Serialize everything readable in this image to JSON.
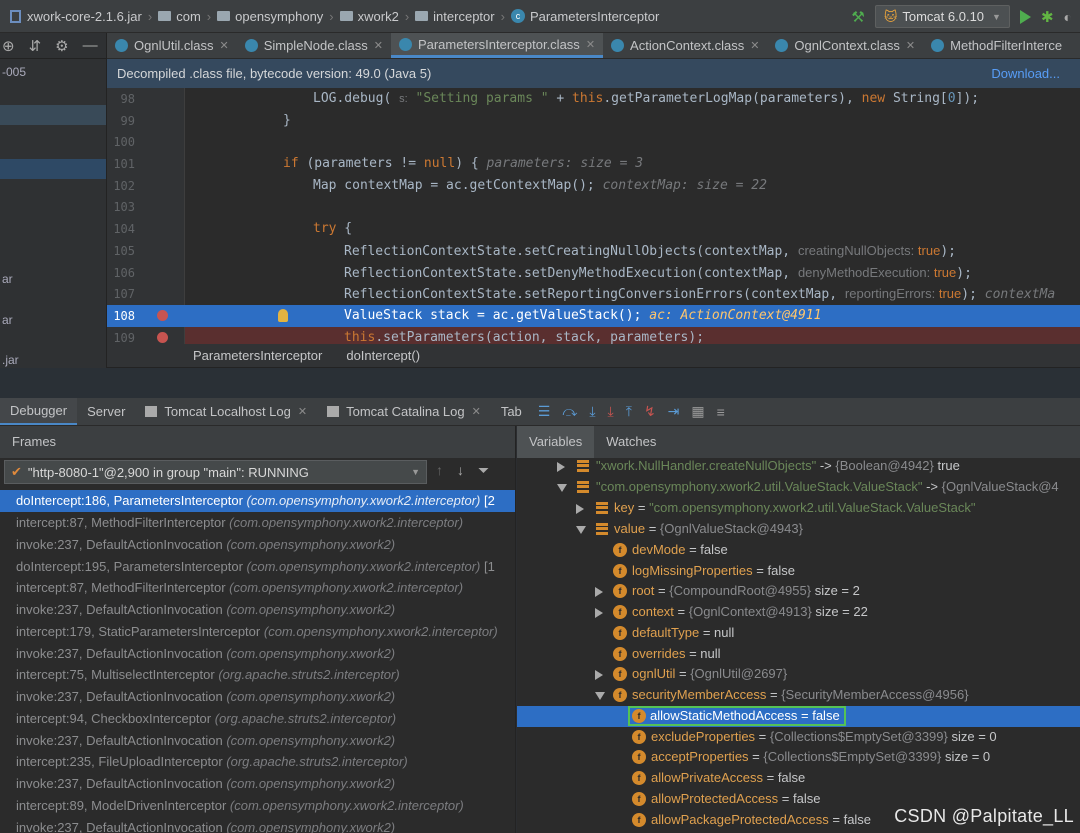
{
  "navbar": {
    "jar": "xwork-core-2.1.6.jar",
    "crumbs": [
      "com",
      "opensymphony",
      "xwork2",
      "interceptor"
    ],
    "class_name": "ParametersInterceptor",
    "run_config": "Tomcat 6.0.10"
  },
  "left_strip": {
    "label_005": "-005",
    "label_ar1": "ar",
    "label_ar2": "ar",
    "label_jar": ".jar"
  },
  "tabs": [
    {
      "label": "OgnlUtil.class",
      "active": false
    },
    {
      "label": "SimpleNode.class",
      "active": false
    },
    {
      "label": "ParametersInterceptor.class",
      "active": true
    },
    {
      "label": "ActionContext.class",
      "active": false
    },
    {
      "label": "OgnlContext.class",
      "active": false
    },
    {
      "label": "MethodFilterInterce",
      "active": false
    }
  ],
  "banner": {
    "text": "Decompiled .class file, bytecode version: 49.0 (Java 5)",
    "download": "Download..."
  },
  "code": {
    "line_numbers": [
      "98",
      "99",
      "100",
      "101",
      "102",
      "103",
      "104",
      "105",
      "106",
      "107",
      "108",
      "109"
    ],
    "l98_a": "LOG.debug(",
    "l98_s": "s:",
    "l98_str": "\"Setting params \"",
    "l98_b": " + ",
    "l98_this": "this",
    "l98_c": ".getParameterLogMap(parameters), ",
    "l98_new": "new",
    "l98_d": " String[",
    "l98_zero": "0",
    "l98_e": "]);",
    "l99": "}",
    "l101_if": "if",
    "l101_a": " (parameters != ",
    "l101_null": "null",
    "l101_b": ") {",
    "l101_hint": "parameters:  size = 3",
    "l102": "Map contextMap = ac.getContextMap();",
    "l102_hint": "contextMap:  size = 22",
    "l104_try": "try",
    "l104_b": " {",
    "l105": "ReflectionContextState.setCreatingNullObjects(contextMap,",
    "l105_hint_k": "creatingNullObjects:",
    "l105_hint_v": "true",
    "l105_end": ");",
    "l106": "ReflectionContextState.setDenyMethodExecution(contextMap,",
    "l106_hint_k": "denyMethodExecution:",
    "l106_hint_v": "true",
    "l106_end": ");",
    "l107": "ReflectionContextState.setReportingConversionErrors(contextMap,",
    "l107_hint_k": "reportingErrors:",
    "l107_hint_v": "true",
    "l107_end": ");",
    "l107_hint2": "contextMa",
    "l108": "ValueStack stack = ac.getValueStack();",
    "l108_hint": "ac: ActionContext@4911",
    "l109_this": "this",
    "l109": ".setParameters(action, stack, parameters);"
  },
  "code_crumb": {
    "cls": "ParametersInterceptor",
    "method": "doIntercept()"
  },
  "debug_tabs": {
    "debugger": "Debugger",
    "server": "Server",
    "localhost_log": "Tomcat Localhost Log",
    "catalina_log": "Tomcat Catalina Log",
    "tab": "Tab"
  },
  "frames": {
    "header": "Frames",
    "thread": "\"http-8080-1\"@2,900 in group \"main\": RUNNING",
    "items": [
      {
        "m": "doIntercept:186, ParametersInterceptor ",
        "p": "(com.opensymphony.xwork2.interceptor)",
        "x": " [2"
      },
      {
        "m": "intercept:87, MethodFilterInterceptor ",
        "p": "(com.opensymphony.xwork2.interceptor)",
        "x": ""
      },
      {
        "m": "invoke:237, DefaultActionInvocation ",
        "p": "(com.opensymphony.xwork2)",
        "x": ""
      },
      {
        "m": "doIntercept:195, ParametersInterceptor ",
        "p": "(com.opensymphony.xwork2.interceptor)",
        "x": " [1"
      },
      {
        "m": "intercept:87, MethodFilterInterceptor ",
        "p": "(com.opensymphony.xwork2.interceptor)",
        "x": ""
      },
      {
        "m": "invoke:237, DefaultActionInvocation ",
        "p": "(com.opensymphony.xwork2)",
        "x": ""
      },
      {
        "m": "intercept:179, StaticParametersInterceptor ",
        "p": "(com.opensymphony.xwork2.interceptor)",
        "x": ""
      },
      {
        "m": "invoke:237, DefaultActionInvocation ",
        "p": "(com.opensymphony.xwork2)",
        "x": ""
      },
      {
        "m": "intercept:75, MultiselectInterceptor ",
        "p": "(org.apache.struts2.interceptor)",
        "x": ""
      },
      {
        "m": "invoke:237, DefaultActionInvocation ",
        "p": "(com.opensymphony.xwork2)",
        "x": ""
      },
      {
        "m": "intercept:94, CheckboxInterceptor ",
        "p": "(org.apache.struts2.interceptor)",
        "x": ""
      },
      {
        "m": "invoke:237, DefaultActionInvocation ",
        "p": "(com.opensymphony.xwork2)",
        "x": ""
      },
      {
        "m": "intercept:235, FileUploadInterceptor ",
        "p": "(org.apache.struts2.interceptor)",
        "x": ""
      },
      {
        "m": "invoke:237, DefaultActionInvocation ",
        "p": "(com.opensymphony.xwork2)",
        "x": ""
      },
      {
        "m": "intercept:89, ModelDrivenInterceptor ",
        "p": "(com.opensymphony.xwork2.interceptor)",
        "x": ""
      },
      {
        "m": "invoke:237, DefaultActionInvocation ",
        "p": "(com.opensymphony.xwork2)",
        "x": ""
      }
    ]
  },
  "variables": {
    "tab_variables": "Variables",
    "tab_watches": "Watches",
    "rows": {
      "r0_k": "\"xwork.NullHandler.createNullObjects\"",
      "r0_a": " -> ",
      "r0_ref": "{Boolean@4942}",
      "r0_v": " true",
      "r1_k": "\"com.opensymphony.xwork2.util.ValueStack.ValueStack\"",
      "r1_a": " -> ",
      "r1_ref": "{OgnlValueStack@4",
      "r2_n": "key",
      "r2_eq": " = ",
      "r2_v": "\"com.opensymphony.xwork2.util.ValueStack.ValueStack\"",
      "r3_n": "value",
      "r3_eq": " = ",
      "r3_ref": "{OgnlValueStack@4943}",
      "r4_n": "devMode",
      "r4_v": " = false",
      "r5_n": "logMissingProperties",
      "r5_v": " = false",
      "r6_n": "root",
      "r6_eq": " = ",
      "r6_ref": "{CompoundRoot@4955}",
      "r6_v": "  size = 2",
      "r7_n": "context",
      "r7_eq": " = ",
      "r7_ref": "{OgnlContext@4913}",
      "r7_v": "  size = 22",
      "r8_n": "defaultType",
      "r8_v": " = null",
      "r9_n": "overrides",
      "r9_v": " = null",
      "r10_n": "ognlUtil",
      "r10_eq": " = ",
      "r10_ref": "{OgnlUtil@2697}",
      "r11_n": "securityMemberAccess",
      "r11_eq": " = ",
      "r11_ref": "{SecurityMemberAccess@4956}",
      "r12_text": "allowStaticMethodAccess = false",
      "r13_n": "excludeProperties",
      "r13_eq": " = ",
      "r13_ref": "{Collections$EmptySet@3399}",
      "r13_v": "  size = 0",
      "r14_n": "acceptProperties",
      "r14_eq": " = ",
      "r14_ref": "{Collections$EmptySet@3399}",
      "r14_v": "  size = 0",
      "r15_n": "allowPrivateAccess",
      "r15_v": " = false",
      "r16_n": "allowProtectedAccess",
      "r16_v": " = false",
      "r17_n": "allowPackageProtectedAccess",
      "r17_v": " = false"
    }
  },
  "watermark": "CSDN @Palpitate_LL",
  "colors": {
    "selection": "#2d6ec4",
    "field_icon": "#d48a2c",
    "highlight_box": "#55c255",
    "breakpoint": "#c75450"
  }
}
